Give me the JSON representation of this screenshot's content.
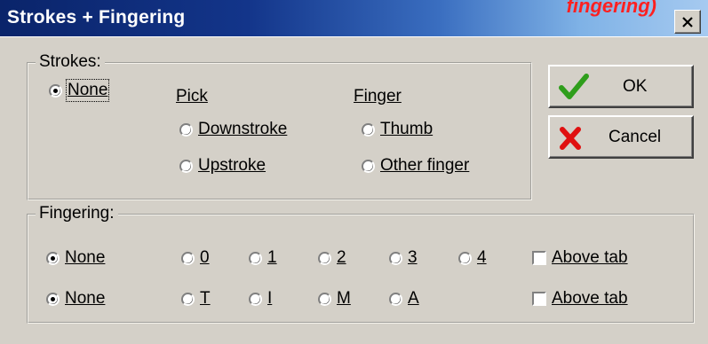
{
  "window": {
    "title": "Strokes + Fingering",
    "overlay_text": "fingering)"
  },
  "strokes": {
    "legend": "Strokes:",
    "none_label": "None",
    "pick": {
      "heading": "Pick",
      "downstroke": "Downstroke",
      "upstroke": "Upstroke"
    },
    "finger": {
      "heading": "Finger",
      "thumb": "Thumb",
      "other": "Other finger"
    }
  },
  "fingering": {
    "legend": "Fingering:",
    "row1": {
      "none": "None",
      "options": [
        "0",
        "1",
        "2",
        "3",
        "4"
      ],
      "above_tab": "Above tab"
    },
    "row2": {
      "none": "None",
      "options": [
        "T",
        "I",
        "M",
        "A"
      ],
      "above_tab": "Above tab"
    }
  },
  "buttons": {
    "ok": "OK",
    "cancel": "Cancel"
  },
  "colors": {
    "title_start": "#0a246a",
    "title_end": "#a6caf0",
    "face": "#d4d0c8",
    "check": "#2f9e1c",
    "cross": "#e01010"
  }
}
